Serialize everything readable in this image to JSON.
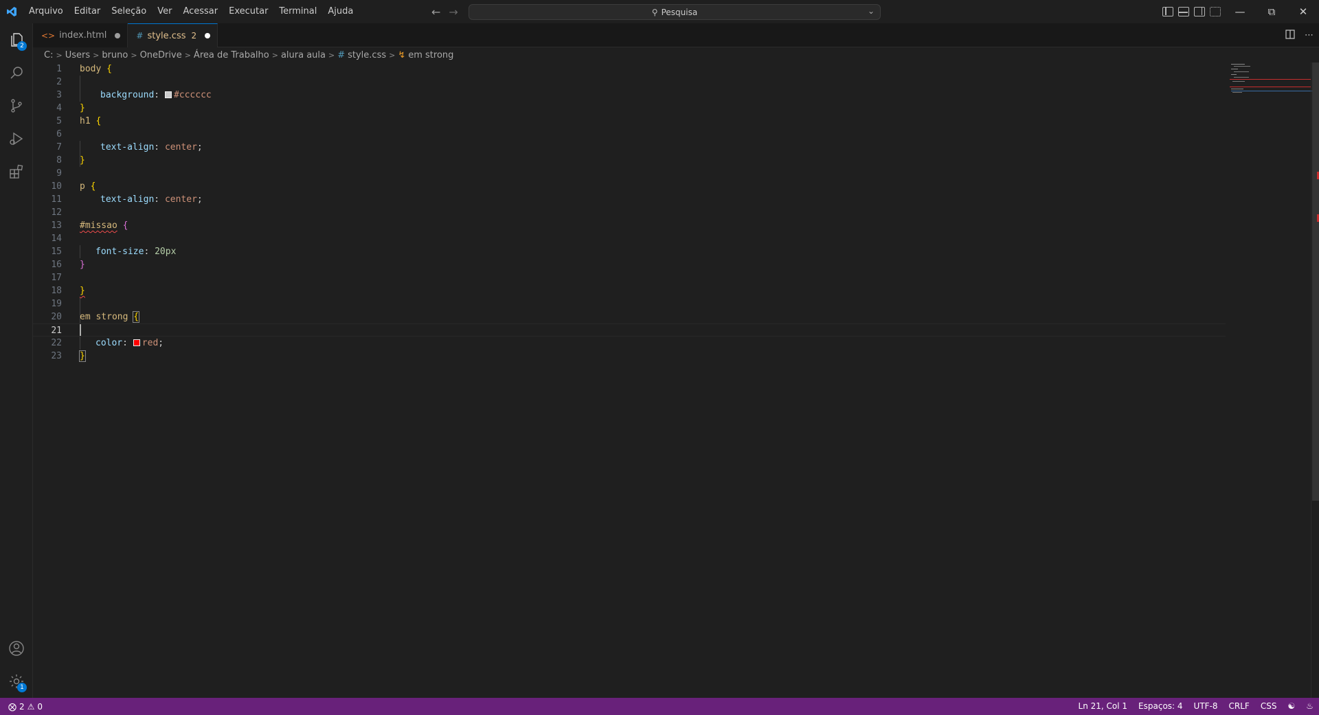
{
  "menu": [
    "Arquivo",
    "Editar",
    "Seleção",
    "Ver",
    "Acessar",
    "Executar",
    "Terminal",
    "Ajuda"
  ],
  "command_center": {
    "label": "Pesquisa"
  },
  "activity_bar": {
    "explorer_badge": "2",
    "settings_badge": "1"
  },
  "tabs": [
    {
      "label": "index.html",
      "icon": "html-file-icon",
      "count": ""
    },
    {
      "label": "style.css",
      "icon": "css-file-icon",
      "count": "2"
    }
  ],
  "breadcrumb": [
    "C:",
    "Users",
    "bruno",
    "OneDrive",
    "Área de Trabalho",
    "alura aula",
    "style.css",
    "em strong"
  ],
  "code": {
    "lines": [
      "1",
      "2",
      "3",
      "4",
      "5",
      "6",
      "7",
      "8",
      "9",
      "10",
      "11",
      "12",
      "13",
      "14",
      "15",
      "16",
      "17",
      "18",
      "19",
      "20",
      "21",
      "22",
      "23"
    ],
    "body_selector": "body",
    "background_prop": "background",
    "background_val": "#cccccc",
    "h1_selector": "h1",
    "text_align_prop": "text-align",
    "center_val": "center",
    "p_selector": "p",
    "missao_selector": "#missao",
    "font_size_prop": "font-size",
    "font_size_val": "20px",
    "em_strong_selector": "em strong",
    "color_prop": "color",
    "color_val": "red",
    "swatch_colors": {
      "background": "#cccccc",
      "color": "#ff0000"
    }
  },
  "status": {
    "errors": "2",
    "warnings": "0",
    "position": "Ln 21, Col 1",
    "spaces": "Espaços: 4",
    "encoding": "UTF-8",
    "eol": "CRLF",
    "language": "CSS"
  },
  "colors": {
    "statusbar": "#68217a",
    "accent": "#0078d4"
  }
}
